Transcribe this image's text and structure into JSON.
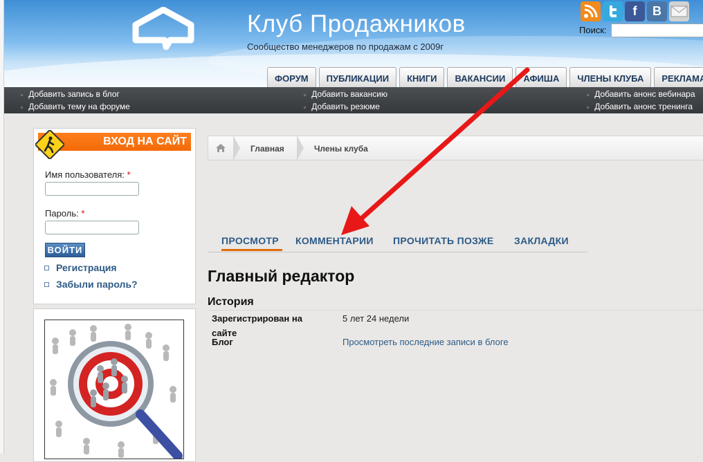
{
  "site": {
    "title": "Клуб Продажников",
    "subtitle": "Сообщество менеджеров по продажам с 2009г"
  },
  "search": {
    "label": "Поиск:",
    "value": ""
  },
  "social": [
    {
      "icon": "rss-icon",
      "color": "#f28a1c",
      "glyph": ""
    },
    {
      "icon": "twitter-icon",
      "color": "#35a9e0",
      "glyph": ""
    },
    {
      "icon": "facebook-icon",
      "color": "#3b5998",
      "glyph": "f"
    },
    {
      "icon": "vkontakte-icon",
      "color": "#4a76a8",
      "glyph": "B"
    },
    {
      "icon": "mail-icon",
      "color": "#c8c8c8",
      "glyph": ""
    }
  ],
  "nav": [
    "ФОРУМ",
    "ПУБЛИКАЦИИ",
    "КНИГИ",
    "ВАКАНСИИ",
    "АФИША",
    "ЧЛЕНЫ КЛУБА",
    "РЕКЛАМА"
  ],
  "quick_links": {
    "blog_add": "Добавить запись в блог",
    "forum_topic": "Добавить тему на форуме",
    "vacancy_add": "Добавить вакансию",
    "resume_add": "Добавить резюме",
    "webinar_add": "Добавить анонс вебинара",
    "training_add": "Добавить анонс тренинга"
  },
  "login": {
    "header": "ВХОД НА САЙТ",
    "username_label": "Имя пользователя:",
    "password_label": "Пароль:",
    "required_mark": "*",
    "username_value": "",
    "password_value": "",
    "submit_label": "ВОЙТИ",
    "register_link": "Регистрация",
    "forgot_link": "Забыли пароль?"
  },
  "breadcrumb": {
    "home": "Главная",
    "current": "Члены клуба"
  },
  "profile_tabs": [
    "ПРОСМОТР",
    "КОММЕНТАРИИ",
    "ПРОЧИТАТЬ ПОЗЖЕ",
    "ЗАКЛАДКИ"
  ],
  "profile_tabs_active": "ПРОСМОТР",
  "profile": {
    "name": "Главный редактор",
    "section": "История",
    "registered_label_1": "Зарегистрирован на",
    "registered_label_2": "сайте",
    "registered_value": "5 лет 24 недели",
    "blog_label": "Блог",
    "blog_link": "Просмотреть последние записи в блоге"
  },
  "colors": {
    "accent_orange": "#f36a07",
    "link_blue": "#2d5a87",
    "arrow_red": "#e81818",
    "dark_bar": "#3e4145"
  }
}
